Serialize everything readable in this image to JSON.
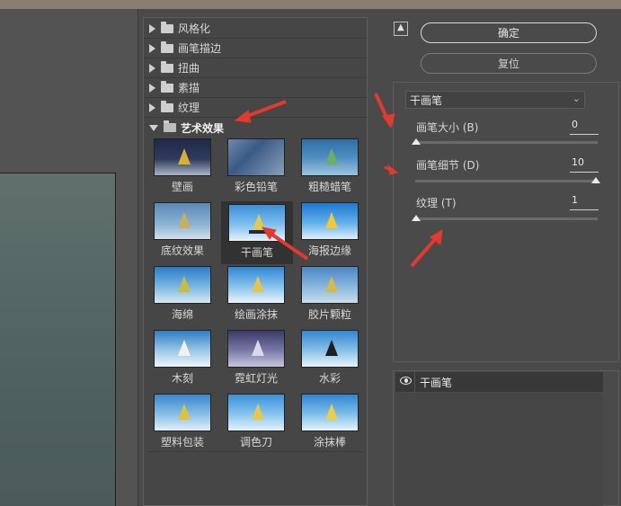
{
  "categories": [
    {
      "label": "风格化",
      "expanded": false
    },
    {
      "label": "画笔描边",
      "expanded": false
    },
    {
      "label": "扭曲",
      "expanded": false
    },
    {
      "label": "素描",
      "expanded": false
    },
    {
      "label": "纹理",
      "expanded": false
    },
    {
      "label": "艺术效果",
      "expanded": true
    }
  ],
  "filters": [
    {
      "label": "壁画"
    },
    {
      "label": "彩色铅笔"
    },
    {
      "label": "粗糙蜡笔"
    },
    {
      "label": "底纹效果"
    },
    {
      "label": "干画笔",
      "selected": true
    },
    {
      "label": "海报边缘"
    },
    {
      "label": "海绵"
    },
    {
      "label": "绘画涂抹"
    },
    {
      "label": "胶片颗粒"
    },
    {
      "label": "木刻"
    },
    {
      "label": "霓虹灯光"
    },
    {
      "label": "水彩"
    },
    {
      "label": "塑料包装"
    },
    {
      "label": "调色刀"
    },
    {
      "label": "涂抹棒"
    }
  ],
  "buttons": {
    "ok": "确定",
    "reset": "复位"
  },
  "settings": {
    "selected_filter": "干画笔",
    "params": [
      {
        "label": "画笔大小 (B)",
        "value": "0",
        "level": 0.0
      },
      {
        "label": "画笔细节 (D)",
        "value": "10",
        "level": 1.0
      },
      {
        "label": "纹理 (T)",
        "value": "1",
        "level": 0.0
      }
    ]
  },
  "layers": {
    "items": [
      {
        "label": "干画笔",
        "visible": true
      }
    ]
  },
  "colors": {
    "accent_arrow": "#e23a2e",
    "panel_bg": "#4a4a4a"
  },
  "icons": {
    "collapse": "collapse-up-icon",
    "folder": "folder-icon",
    "eye": "eye-icon",
    "dropdown": "chevron-down-icon"
  }
}
